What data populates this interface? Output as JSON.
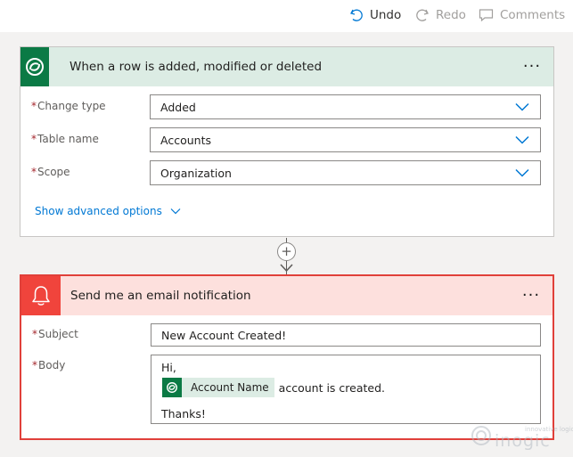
{
  "toolbar": {
    "undo_label": "Undo",
    "redo_label": "Redo",
    "comments_label": "Comments"
  },
  "trigger": {
    "title": "When a row is added, modified or deleted",
    "fields": [
      {
        "label": "Change type",
        "value": "Added"
      },
      {
        "label": "Table name",
        "value": "Accounts"
      },
      {
        "label": "Scope",
        "value": "Organization"
      }
    ],
    "advanced_label": "Show advanced options",
    "required_marker": "*"
  },
  "connector": {
    "plus_symbol": "+"
  },
  "email_action": {
    "title": "Send me an email notification",
    "subject_label": "Subject",
    "subject_value": "New Account Created!",
    "body_label": "Body",
    "body_greeting": "Hi,",
    "token_label": "Account Name",
    "body_after_token": "account is created.",
    "body_closing": "Thanks!",
    "required_marker": "*"
  },
  "watermark": {
    "tagline": "innovative logic",
    "brand": "inogic"
  },
  "colors": {
    "dataverse_green": "#0b7a45",
    "trigger_header": "#dcece4",
    "email_red": "#f0443c",
    "email_header": "#fde0dd",
    "link_blue": "#0078d4",
    "required_red": "#a4262c"
  },
  "icons": {
    "undo": "undo-icon",
    "redo": "redo-icon",
    "comments": "comment-icon",
    "dataverse": "dataverse-logo-icon",
    "bell": "bell-icon",
    "chevron": "chevron-down-icon",
    "more": "more-options-icon"
  }
}
